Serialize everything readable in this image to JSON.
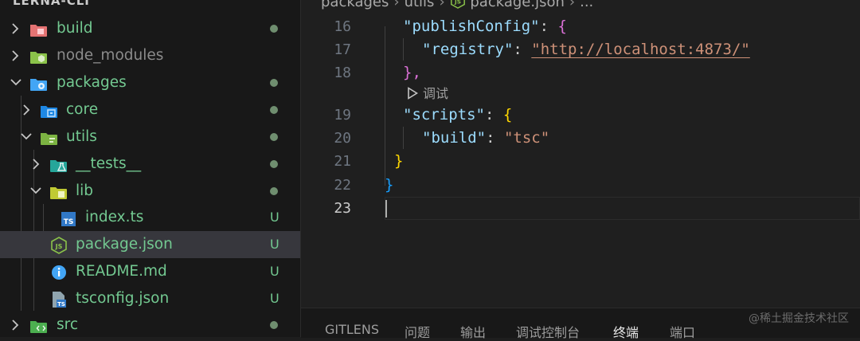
{
  "explorer": {
    "title": "LERNA-CLI",
    "items": [
      {
        "label": "build",
        "icon": "folder-build-icon",
        "expanded": false,
        "status": "dot"
      },
      {
        "label": "node_modules",
        "icon": "folder-node-icon",
        "expanded": false,
        "status": ""
      },
      {
        "label": "packages",
        "icon": "folder-packages-icon",
        "expanded": true,
        "status": "dot"
      },
      {
        "label": "core",
        "icon": "folder-core-icon",
        "expanded": false,
        "status": "dot"
      },
      {
        "label": "utils",
        "icon": "folder-utils-icon",
        "expanded": true,
        "status": "dot"
      },
      {
        "label": "__tests__",
        "icon": "folder-test-icon",
        "expanded": false,
        "status": "dot"
      },
      {
        "label": "lib",
        "icon": "folder-lib-icon",
        "expanded": true,
        "status": "dot"
      },
      {
        "label": "index.ts",
        "icon": "typescript-file-icon",
        "status": "U"
      },
      {
        "label": "package.json",
        "icon": "nodejs-file-icon",
        "status": "U",
        "selected": true
      },
      {
        "label": "README.md",
        "icon": "info-file-icon",
        "status": "U"
      },
      {
        "label": "tsconfig.json",
        "icon": "tsconfig-file-icon",
        "status": "U"
      },
      {
        "label": "src",
        "icon": "folder-src-icon",
        "expanded": false,
        "status": "dot"
      }
    ]
  },
  "breadcrumb": {
    "parts": [
      "packages",
      "utils",
      "package.json",
      "..."
    ]
  },
  "editor": {
    "lines": [
      {
        "num": "16",
        "key": "\"publishConfig\"",
        "colon": ": ",
        "open": "{"
      },
      {
        "num": "17",
        "key": "\"registry\"",
        "colon": ": ",
        "value": "\"http://localhost:4873/\""
      },
      {
        "num": "18",
        "close": "},"
      },
      {
        "num": "19",
        "key": "\"scripts\"",
        "colon": ": ",
        "open": "{"
      },
      {
        "num": "20",
        "key": "\"build\"",
        "colon": ": ",
        "value": "\"tsc\""
      },
      {
        "num": "21",
        "close": "}"
      },
      {
        "num": "22",
        "close": "}"
      },
      {
        "num": "23"
      }
    ],
    "codelens": "调试"
  },
  "panel": {
    "tabs": [
      "GITLENS",
      "问题",
      "输出",
      "调试控制台",
      "终端",
      "端口"
    ],
    "active_tab": "终端"
  },
  "watermark": "@稀土掘金技术社区"
}
